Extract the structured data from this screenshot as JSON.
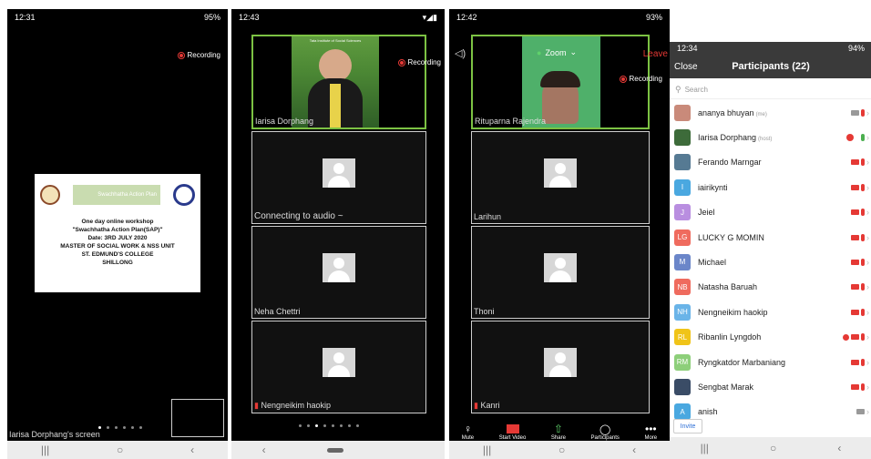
{
  "phone1": {
    "time": "12:31",
    "battery": "95%",
    "recording": "Recording",
    "slide": {
      "banner": "Swachhatha Action Plan",
      "line1": "One day online workshop",
      "line2": "\"Swachhatha Action Plan(SAP)\"",
      "line3": "Date: 3RD JULY 2020",
      "line4": "MASTER OF SOCIAL WORK & NSS UNIT",
      "line5": "ST. EDMUND'S COLLEGE",
      "line6": "SHILLONG"
    },
    "screen_label": "Iarisa Dorphang's screen"
  },
  "phone2": {
    "time": "12:43",
    "recording": "Recording",
    "banner": "Tata Institute of Social Sciences",
    "tiles": [
      {
        "name": "Iarisa Dorphang"
      },
      {
        "name": "Connecting to audio ~"
      },
      {
        "name": "Neha Chettri"
      },
      {
        "name": "Nengneikim haokip"
      }
    ]
  },
  "phone3": {
    "time": "12:42",
    "battery": "93%",
    "zoom": "Zoom",
    "leave": "Leave",
    "recording": "Recording",
    "tiles": [
      {
        "name": "Rituparna Rajendra"
      },
      {
        "name": "Larihun"
      },
      {
        "name": "Thoni"
      },
      {
        "name": "Kanri"
      }
    ],
    "toolbar": {
      "mute": "Mute",
      "start_video": "Start Video",
      "share": "Share",
      "participants": "Participants",
      "more": "More"
    }
  },
  "phone4": {
    "time": "12:34",
    "battery": "94%",
    "close": "Close",
    "title": "Participants (22)",
    "search_placeholder": "Search",
    "invite": "Invite",
    "participants": [
      {
        "initials": "",
        "name": "ananya bhuyan",
        "tag": "(me)",
        "color": "#c98a7a",
        "cam": "on",
        "mic": "off"
      },
      {
        "initials": "",
        "name": "Iarisa Dorphang",
        "tag": "(host)",
        "color": "#3d6b3a",
        "cam": "rec",
        "mic": "on"
      },
      {
        "initials": "",
        "name": "Ferando Marngar",
        "tag": "",
        "color": "#567a93",
        "cam": "off",
        "mic": "off"
      },
      {
        "initials": "I",
        "name": "iairikynti",
        "tag": "",
        "color": "#4aa8e0",
        "cam": "off",
        "mic": "off"
      },
      {
        "initials": "J",
        "name": "Jeiel",
        "tag": "",
        "color": "#b98ee0",
        "cam": "off",
        "mic": "off"
      },
      {
        "initials": "LG",
        "name": "LUCKY G MOMIN",
        "tag": "",
        "color": "#ef6b5e",
        "cam": "off",
        "mic": "off"
      },
      {
        "initials": "M",
        "name": "Michael",
        "tag": "",
        "color": "#6b86c9",
        "cam": "off",
        "mic": "off"
      },
      {
        "initials": "NB",
        "name": "Natasha Baruah",
        "tag": "",
        "color": "#ef6b5e",
        "cam": "off",
        "mic": "off"
      },
      {
        "initials": "NH",
        "name": "Nengneikim haokip",
        "tag": "",
        "color": "#6ab4e8",
        "cam": "off",
        "mic": "off"
      },
      {
        "initials": "RL",
        "name": "Ribanlin Lyngdoh",
        "tag": "",
        "color": "#f0c419",
        "cam": "off",
        "mic": "off",
        "badge": true
      },
      {
        "initials": "RM",
        "name": "Ryngkatdor Marbaniang",
        "tag": "",
        "color": "#8dcf7a",
        "cam": "off",
        "mic": "off"
      },
      {
        "initials": "",
        "name": "Sengbat Marak",
        "tag": "",
        "color": "#3a4c66",
        "cam": "off",
        "mic": "off"
      },
      {
        "initials": "A",
        "name": "anish",
        "tag": "",
        "color": "#4aa8e0",
        "cam": "on",
        "mic": "none"
      }
    ]
  }
}
